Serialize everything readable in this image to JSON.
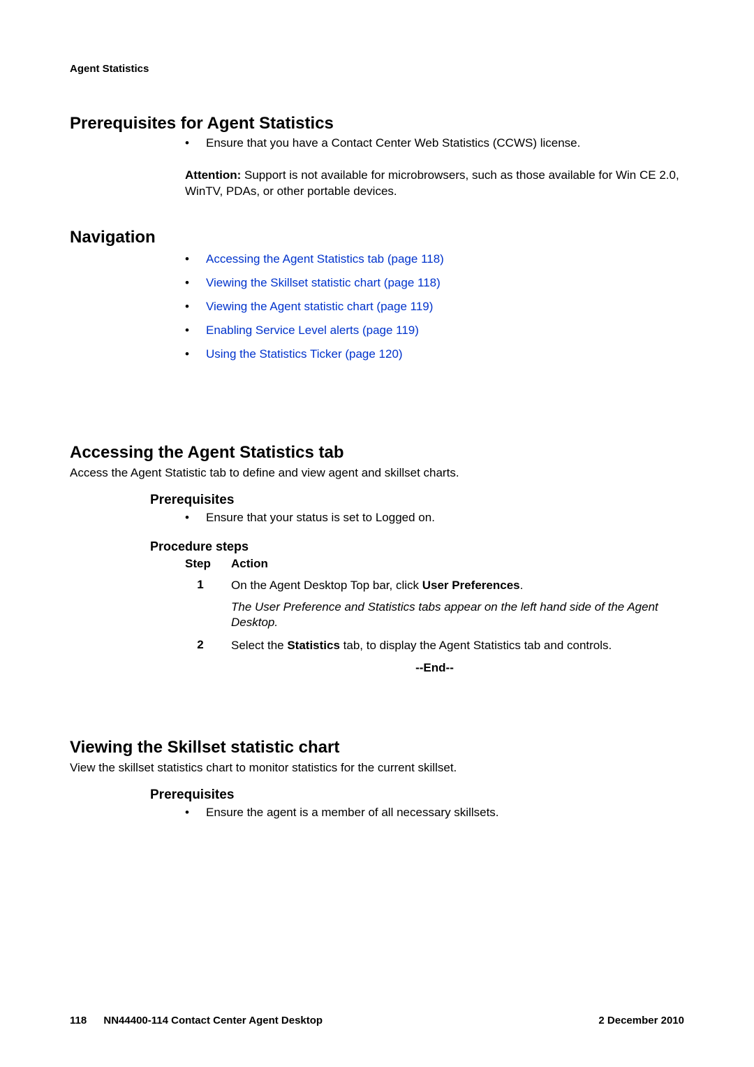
{
  "running_header": "Agent Statistics",
  "sections": {
    "prereq_title": "Prerequisites for Agent Statistics",
    "prereq_bullet": "Ensure that you have a Contact Center Web Statistics (CCWS) license.",
    "attention_label": "Attention:",
    "attention_body": "Support is not available for microbrowsers, such as those available for Win CE 2.0, WinTV, PDAs, or other portable devices.",
    "nav_title": "Navigation",
    "nav_items": [
      "Accessing the Agent Statistics tab (page 118)",
      "Viewing the Skillset statistic chart (page 118)",
      "Viewing the Agent statistic chart (page 119)",
      "Enabling Service Level alerts (page 119)",
      "Using the Statistics Ticker (page 120)"
    ],
    "access_title": "Accessing the Agent Statistics tab",
    "access_body": "Access the Agent Statistic tab to define and view agent and skillset charts.",
    "access_prereq_h": "Prerequisites",
    "access_prereq_bullet": "Ensure that your status is set to Logged on.",
    "proc_h": "Procedure steps",
    "step_label": "Step",
    "action_label": "Action",
    "step1_num": "1",
    "step1_a_pre": "On the Agent Desktop Top bar, click ",
    "step1_a_bold": "User Preferences",
    "step1_a_post": ".",
    "step1_desc": "The User Preference and Statistics tabs appear on the left hand side of the Agent Desktop.",
    "step2_num": "2",
    "step2_pre": "Select the ",
    "step2_bold": "Statistics",
    "step2_post": " tab, to display the Agent Statistics tab and controls.",
    "end": "--End--",
    "view_title": "Viewing the Skillset statistic chart",
    "view_body": "View the skillset statistics chart to monitor statistics for the current skillset.",
    "view_prereq_h": "Prerequisites",
    "view_prereq_bullet": "Ensure the agent is a member of all necessary skillsets."
  },
  "footer": {
    "page_num": "118",
    "doc_id": "NN44400-114 Contact Center Agent Desktop",
    "date": "2 December 2010"
  }
}
